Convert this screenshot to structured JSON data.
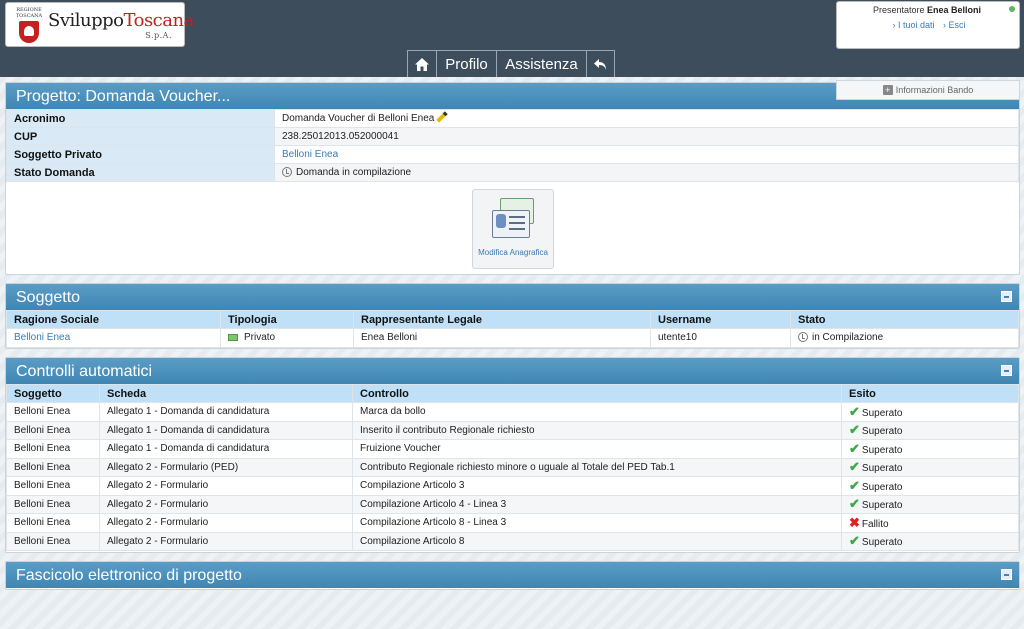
{
  "header": {
    "logo": {
      "region": "REGIONE TOSCANA",
      "brand_part1": "Sviluppo",
      "brand_part2": "Toscana",
      "suffix": "S.p.A."
    },
    "user": {
      "prefix": "Presentatore",
      "name": "Enea Belloni",
      "link_data": "› I tuoi dati",
      "link_exit": "› Esci"
    },
    "nav": [
      {
        "label": "",
        "icon": "home-icon"
      },
      {
        "label": "Profilo"
      },
      {
        "label": "Assistenza"
      },
      {
        "label": "",
        "icon": "back-arrow-icon"
      }
    ],
    "info_bando": "Informazioni Bando"
  },
  "progetto": {
    "title": "Progetto: Domanda Voucher...",
    "fields": [
      {
        "label": "Acronimo",
        "value": "Domanda Voucher di Belloni Enea"
      },
      {
        "label": "CUP",
        "value": "238.25012013.052000041"
      },
      {
        "label": "Soggetto Privato",
        "value": "Belloni Enea"
      },
      {
        "label": "Stato Domanda",
        "value": "Domanda in compilazione"
      }
    ],
    "action_label": "Modifica Anagrafica"
  },
  "soggetto": {
    "title": "Soggetto",
    "columns": [
      "Ragione Sociale",
      "Tipologia",
      "Rappresentante Legale",
      "Username",
      "Stato"
    ],
    "row": {
      "ragione": "Belloni Enea",
      "tipologia": "Privato",
      "rappresentante": "Enea Belloni",
      "username": "utente10",
      "stato": "in Compilazione"
    }
  },
  "controlli": {
    "title": "Controlli automatici",
    "columns": [
      "Soggetto",
      "Scheda",
      "Controllo",
      "Esito"
    ],
    "rows": [
      {
        "soggetto": "Belloni Enea",
        "scheda": "Allegato 1 - Domanda di candidatura",
        "controllo": "Marca da bollo",
        "esito": "Superato",
        "ok": true
      },
      {
        "soggetto": "Belloni Enea",
        "scheda": "Allegato 1 - Domanda di candidatura",
        "controllo": "Inserito il contributo Regionale richiesto",
        "esito": "Superato",
        "ok": true
      },
      {
        "soggetto": "Belloni Enea",
        "scheda": "Allegato 1 - Domanda di candidatura",
        "controllo": "Fruizione Voucher",
        "esito": "Superato",
        "ok": true
      },
      {
        "soggetto": "Belloni Enea",
        "scheda": "Allegato 2 - Formulario (PED)",
        "controllo": "Contributo Regionale richiesto minore o uguale al Totale del PED Tab.1",
        "esito": "Superato",
        "ok": true
      },
      {
        "soggetto": "Belloni Enea",
        "scheda": "Allegato 2 - Formulario",
        "controllo": "Compilazione Articolo 3",
        "esito": "Superato",
        "ok": true
      },
      {
        "soggetto": "Belloni Enea",
        "scheda": "Allegato 2 - Formulario",
        "controllo": "Compilazione Articolo 4 - Linea 3",
        "esito": "Superato",
        "ok": true
      },
      {
        "soggetto": "Belloni Enea",
        "scheda": "Allegato 2 - Formulario",
        "controllo": "Compilazione Articolo 8 - Linea 3",
        "esito": "Fallito",
        "ok": false
      },
      {
        "soggetto": "Belloni Enea",
        "scheda": "Allegato 2 - Formulario",
        "controllo": "Compilazione Articolo 8",
        "esito": "Superato",
        "ok": true
      }
    ]
  },
  "fascicolo": {
    "title": "Fascicolo elettronico di progetto"
  }
}
